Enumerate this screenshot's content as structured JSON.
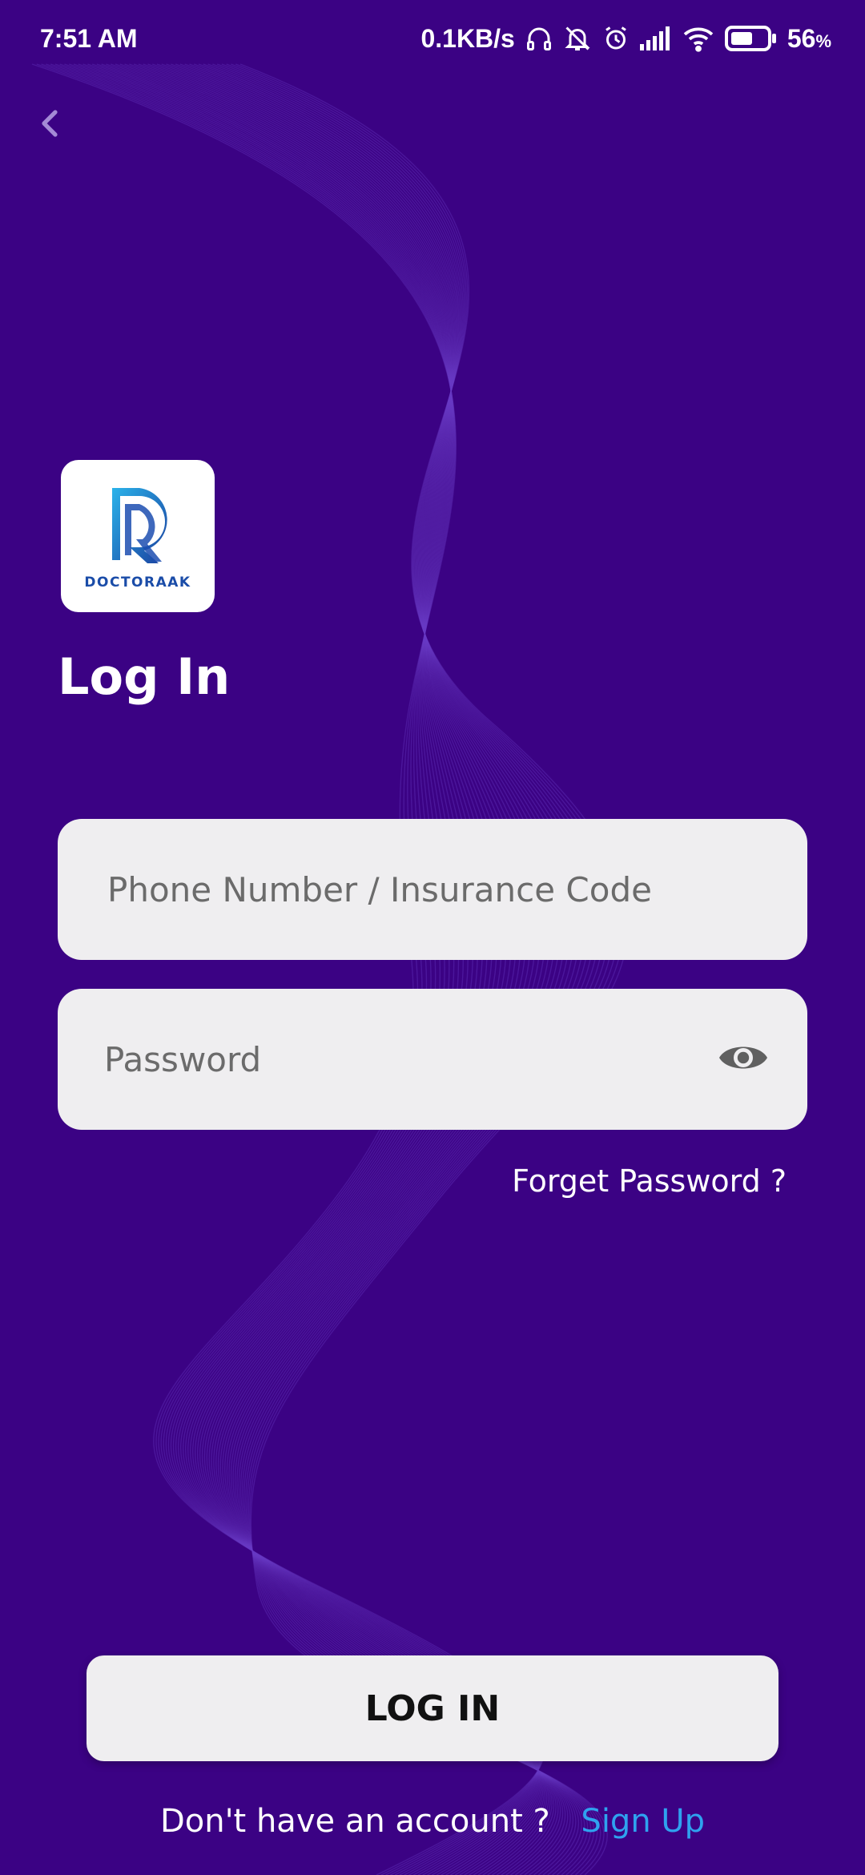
{
  "status_bar": {
    "time": "7:51 AM",
    "network_speed": "0.1KB/s",
    "battery_percent": "56",
    "battery_unit": "%",
    "icons": [
      "headphones-icon",
      "bell-muted-icon",
      "alarm-icon",
      "signal-icon",
      "wifi-icon",
      "battery-icon"
    ]
  },
  "nav": {
    "back_icon": "chevron-left-icon"
  },
  "logo": {
    "text": "DOCTORAAK"
  },
  "page": {
    "title": "Log In"
  },
  "form": {
    "phone_placeholder": "Phone Number / Insurance Code",
    "phone_value": "",
    "password_placeholder": "Password",
    "password_value": "",
    "password_toggle_icon": "eye-icon",
    "forget_password": "Forget Password ?"
  },
  "actions": {
    "login_label": "LOG IN",
    "signup_prompt": "Don't have an account ?",
    "signup_label": "Sign Up"
  },
  "colors": {
    "background": "#3b0284",
    "field_background": "#efeef0",
    "link_accent": "#2fa2ef",
    "logo_blue": "#1a4ca8"
  }
}
